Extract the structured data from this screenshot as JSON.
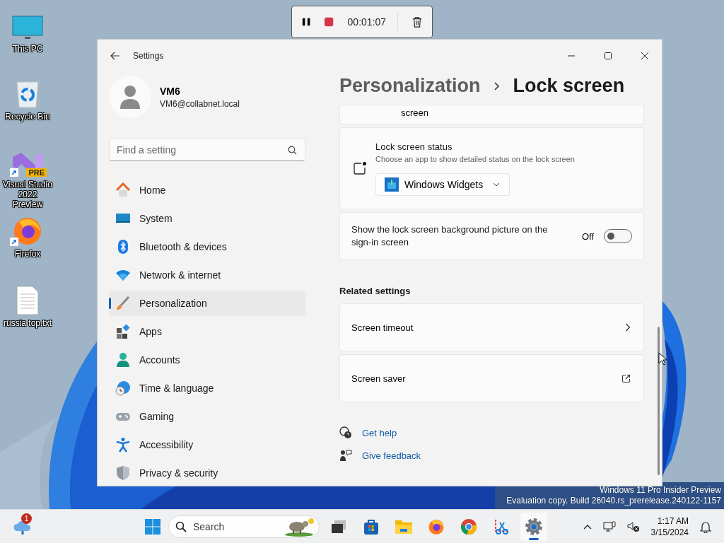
{
  "desktop": {
    "icons": [
      {
        "label": "This PC",
        "shortcut": false
      },
      {
        "label": "Recycle Bin",
        "shortcut": false
      },
      {
        "label": "Visual Studio 2022 Preview",
        "badge": "PRE",
        "shortcut": true
      },
      {
        "label": "Firefox",
        "shortcut": true
      },
      {
        "label": "russia top.txt",
        "shortcut": false
      }
    ]
  },
  "recorder": {
    "elapsed": "00:01:07"
  },
  "window": {
    "title": "Settings",
    "account": {
      "name": "VM6",
      "email": "VM6@collabnet.local"
    },
    "search": {
      "placeholder": "Find a setting"
    },
    "nav": [
      {
        "label": "Home",
        "selected": false
      },
      {
        "label": "System",
        "selected": false
      },
      {
        "label": "Bluetooth & devices",
        "selected": false
      },
      {
        "label": "Network & internet",
        "selected": false
      },
      {
        "label": "Personalization",
        "selected": true
      },
      {
        "label": "Apps",
        "selected": false
      },
      {
        "label": "Accounts",
        "selected": false
      },
      {
        "label": "Time & language",
        "selected": false
      },
      {
        "label": "Gaming",
        "selected": false
      },
      {
        "label": "Accessibility",
        "selected": false
      },
      {
        "label": "Privacy & security",
        "selected": false
      }
    ],
    "breadcrumb": [
      "Personalization",
      "Lock screen"
    ],
    "content": {
      "partial_item": "screen",
      "status_card": {
        "title": "Lock screen status",
        "description": "Choose an app to show detailed status on the lock screen",
        "dropdown": "Windows Widgets"
      },
      "toggle_card": {
        "label": "Show the lock screen background picture on the sign-in screen",
        "state_text": "Off",
        "on": false
      },
      "related": {
        "heading": "Related settings",
        "items": [
          {
            "label": "Screen timeout",
            "kind": "chevron"
          },
          {
            "label": "Screen saver",
            "kind": "external"
          }
        ]
      },
      "help_links": [
        "Get help",
        "Give feedback"
      ]
    }
  },
  "watermark": [
    "Windows 11 Pro Insider Preview",
    "Evaluation copy. Build 26040.rs_prerelease.240122-1157"
  ],
  "taskbar": {
    "weather_badge": "1",
    "search": {
      "placeholder": "Search"
    },
    "apps": [
      {
        "selected": false
      },
      {
        "selected": false
      },
      {
        "selected": false
      },
      {
        "selected": false
      },
      {
        "selected": false
      },
      {
        "selected": false
      },
      {
        "selected": true
      }
    ],
    "clock": {
      "time": "1:17 AM",
      "date": "3/15/2024"
    }
  }
}
